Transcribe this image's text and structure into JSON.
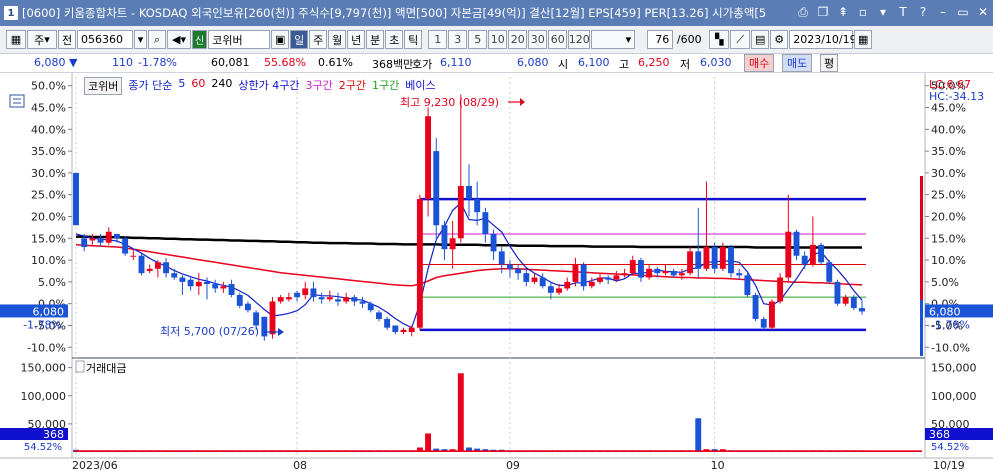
{
  "window": {
    "number": "1",
    "title": "[0600] 키움종합차트 - KOSDAQ 외국인보유[260(천)] 주식수[9,797(천)] 액면[500] 자본금[49(억)] 결산[12월] EPS[459] PER[13.26] 시가총액[5",
    "buttons": [
      "⎙",
      "❐",
      "⇞",
      "▫",
      "▾",
      "T",
      "?",
      "▭",
      "–",
      "▭",
      "✕"
    ]
  },
  "toolbar": {
    "market": "주",
    "prefix": "전",
    "code": "056360",
    "new_badge": "신",
    "stock_name": "코위버",
    "periods": [
      "일",
      "주",
      "월",
      "년",
      "분",
      "초",
      "틱"
    ],
    "minutes": [
      "1",
      "3",
      "5",
      "10",
      "20",
      "30",
      "60",
      "120"
    ],
    "count": "76",
    "total": "/600",
    "date": "2023/10/19"
  },
  "quote": {
    "price": "6,080 ▼",
    "change": "110",
    "rate": "-1.78%",
    "volume": "60,081",
    "vol_ratio": "55.68%",
    "turnover": "0.61%",
    "amount": "368백만",
    "bid_label": "호가",
    "bid": "6,110",
    "ask": "6,080",
    "open_label": "시",
    "open": "6,100",
    "high_label": "고",
    "high": "6,250",
    "low_label": "저",
    "low": "6,030",
    "buy": "매수",
    "sell": "매도",
    "avg": "평"
  },
  "legend": {
    "name": "코위버",
    "ma_label": "종가 단순",
    "ma5": "5",
    "ma60": "60",
    "ma240": "240",
    "env_label": "상한가 4구간",
    "z3": "3구간",
    "z2": "2구간",
    "z1": "1구간",
    "base": "베이스"
  },
  "right_top": {
    "lc": "LC:6.67",
    "hc": "HC:-34.13"
  },
  "annotations": {
    "high": "최고 9,230 (08/29)",
    "low": "최저 5,700 (07/26)"
  },
  "price_axis": [
    "50.0%",
    "45.0%",
    "40.0%",
    "35.0%",
    "30.0%",
    "25.0%",
    "20.0%",
    "15.0%",
    "10.0%",
    "5.0%",
    "0.0%",
    "-5.0%",
    "-10.0%"
  ],
  "price_tag": {
    "value": "6,080",
    "rate": "-1.78%"
  },
  "volume_panel": {
    "label": "거래대금",
    "axis": [
      "150,000",
      "100,000",
      "50,000"
    ],
    "tag": "368",
    "tag_rate": "54.52%"
  },
  "date_axis": [
    "2023/06",
    "08",
    "09",
    "10",
    "10/19"
  ],
  "colors": {
    "up": "#e8001c",
    "down": "#1a53d6",
    "ma5": "#1020c8",
    "ma60": "#e8001c",
    "ma240": "#000000",
    "titlebar": "#5b7db5"
  },
  "chart_data": {
    "type": "candlestick",
    "base_price": 6190,
    "pct_range": [
      -12,
      52
    ],
    "candles": [
      [
        30.0,
        18.0,
        18.0,
        20.3
      ],
      [
        15.0,
        13.0,
        12.0,
        16.0
      ],
      [
        14.5,
        15.0,
        13.5,
        16.0
      ],
      [
        15.0,
        14.0,
        13.0,
        16.0
      ],
      [
        14.0,
        16.5,
        13.5,
        17.5
      ],
      [
        16.0,
        15.0,
        14.0,
        16.0
      ],
      [
        15.0,
        11.5,
        11.0,
        15.5
      ],
      [
        11.0,
        11.0,
        10.0,
        12.5
      ],
      [
        11.0,
        7.0,
        6.5,
        11.5
      ],
      [
        7.5,
        8.0,
        7.0,
        9.0
      ],
      [
        8.0,
        9.5,
        6.0,
        10.0
      ],
      [
        9.5,
        7.0,
        6.0,
        10.5
      ],
      [
        7.0,
        6.0,
        5.5,
        8.0
      ],
      [
        6.0,
        5.0,
        2.0,
        6.5
      ],
      [
        5.5,
        4.0,
        3.0,
        6.0
      ],
      [
        4.0,
        5.0,
        2.0,
        7.0
      ],
      [
        5.0,
        4.5,
        1.0,
        6.0
      ],
      [
        4.5,
        3.5,
        2.5,
        5.5
      ],
      [
        3.5,
        4.0,
        2.5,
        5.0
      ],
      [
        4.5,
        2.0,
        1.5,
        5.5
      ],
      [
        2.0,
        -0.5,
        -1.0,
        2.5
      ],
      [
        0.0,
        -1.5,
        -2.0,
        0.5
      ],
      [
        -2.0,
        -5.0,
        -6.0,
        -1.5
      ],
      [
        -3.0,
        -7.5,
        -8.5,
        -3.0
      ],
      [
        -7.0,
        0.5,
        -8.0,
        1.5
      ],
      [
        0.5,
        1.5,
        0.0,
        2.0
      ],
      [
        1.0,
        1.5,
        0.5,
        2.5
      ],
      [
        2.5,
        1.5,
        0.5,
        3.0
      ],
      [
        2.0,
        3.5,
        1.0,
        5.0
      ],
      [
        3.5,
        1.5,
        0.5,
        5.0
      ],
      [
        1.5,
        1.0,
        0.0,
        2.5
      ],
      [
        1.0,
        1.5,
        0.5,
        3.0
      ],
      [
        1.0,
        0.5,
        -0.5,
        2.5
      ],
      [
        0.5,
        1.5,
        0.0,
        2.5
      ],
      [
        1.5,
        0.5,
        -0.5,
        2.0
      ],
      [
        0.5,
        0.0,
        -1.0,
        1.5
      ],
      [
        0.0,
        -1.5,
        -2.0,
        0.5
      ],
      [
        -2.0,
        -3.5,
        -4.0,
        -1.5
      ],
      [
        -3.5,
        -5.5,
        -6.0,
        -3.0
      ],
      [
        -5.0,
        -6.5,
        -7.0,
        -5.0
      ],
      [
        -6.5,
        -6.0,
        -7.0,
        -5.5
      ],
      [
        -6.5,
        -5.5,
        -7.5,
        -5.0
      ],
      [
        -5.5,
        24.0,
        -6.0,
        25.0
      ],
      [
        24.0,
        43.0,
        20.0,
        45.0
      ],
      [
        35.0,
        18.0,
        15.0,
        38.0
      ],
      [
        18.0,
        12.5,
        10.0,
        19.0
      ],
      [
        12.5,
        15.0,
        8.0,
        19.0
      ],
      [
        15.0,
        27.0,
        14.0,
        48.0
      ],
      [
        27.0,
        24.0,
        20.0,
        32.0
      ],
      [
        24.0,
        21.0,
        18.0,
        28.0
      ],
      [
        21.0,
        16.0,
        14.0,
        22.0
      ],
      [
        16.0,
        12.0,
        10.0,
        17.0
      ],
      [
        12.0,
        9.0,
        7.0,
        13.0
      ],
      [
        9.0,
        8.0,
        6.0,
        10.0
      ],
      [
        8.0,
        7.0,
        5.5,
        9.0
      ],
      [
        7.0,
        5.0,
        4.0,
        8.0
      ],
      [
        5.0,
        6.0,
        4.5,
        7.0
      ],
      [
        6.0,
        4.0,
        3.5,
        7.0
      ],
      [
        4.0,
        2.5,
        1.0,
        5.0
      ],
      [
        2.5,
        3.5,
        2.0,
        4.5
      ],
      [
        3.5,
        5.0,
        3.0,
        6.0
      ],
      [
        5.0,
        9.0,
        4.0,
        10.5
      ],
      [
        9.0,
        4.0,
        3.0,
        9.5
      ],
      [
        4.0,
        5.0,
        3.5,
        6.0
      ],
      [
        5.0,
        6.0,
        4.5,
        7.0
      ],
      [
        6.0,
        5.5,
        4.5,
        6.5
      ],
      [
        5.5,
        6.5,
        5.0,
        7.5
      ],
      [
        6.5,
        7.0,
        6.0,
        8.0
      ],
      [
        7.0,
        10.0,
        6.5,
        11.0
      ],
      [
        10.0,
        6.0,
        5.0,
        10.5
      ],
      [
        6.0,
        8.0,
        5.5,
        9.0
      ],
      [
        8.0,
        7.0,
        6.0,
        8.5
      ],
      [
        7.0,
        7.5,
        6.5,
        9.0
      ],
      [
        7.5,
        6.5,
        6.0,
        8.0
      ],
      [
        6.5,
        7.0,
        5.5,
        8.0
      ],
      [
        7.0,
        12.0,
        6.5,
        13.0
      ],
      [
        12.0,
        8.0,
        6.0,
        22.0
      ],
      [
        8.0,
        13.0,
        7.5,
        28.0
      ],
      [
        13.0,
        8.0,
        7.0,
        14.0
      ],
      [
        8.0,
        13.0,
        7.5,
        14.0
      ],
      [
        13.0,
        7.0,
        6.0,
        13.5
      ],
      [
        7.0,
        6.5,
        5.5,
        8.0
      ],
      [
        6.5,
        2.0,
        1.5,
        7.0
      ],
      [
        2.0,
        -3.5,
        -4.0,
        2.5
      ],
      [
        -3.5,
        -5.5,
        -6.0,
        -3.0
      ],
      [
        -5.5,
        0.5,
        -6.0,
        1.0
      ],
      [
        0.5,
        6.0,
        0.0,
        7.0
      ],
      [
        6.0,
        16.5,
        5.0,
        25.0
      ],
      [
        16.5,
        11.0,
        10.0,
        17.0
      ],
      [
        11.0,
        9.0,
        8.0,
        12.0
      ],
      [
        9.0,
        13.5,
        8.5,
        20.0
      ],
      [
        13.5,
        9.5,
        9.0,
        14.0
      ],
      [
        9.5,
        5.0,
        4.5,
        10.0
      ],
      [
        5.0,
        0.0,
        -0.5,
        5.5
      ],
      [
        0.0,
        1.5,
        -0.5,
        2.0
      ],
      [
        1.5,
        -1.0,
        -1.5,
        2.0
      ],
      [
        -1.0,
        -1.78,
        -2.5,
        0.8
      ]
    ],
    "ma5": [
      16,
      15.5,
      15,
      14.8,
      14.6,
      14.4,
      13.6,
      12.6,
      11.6,
      10.4,
      9.4,
      8.6,
      7.6,
      6.8,
      6.2,
      5.6,
      5.2,
      4.6,
      4.2,
      3.8,
      2.9,
      1.9,
      0.3,
      -1.3,
      -2.8,
      -2.6,
      -2.2,
      -1.6,
      -0.2,
      2.1,
      1.8,
      1.8,
      1.6,
      1.3,
      1.0,
      0.8,
      0.0,
      -0.8,
      -2.0,
      -3.4,
      -4.6,
      -5.5,
      0.0,
      8.0,
      14.7,
      17.7,
      21.4,
      23.1,
      19.3,
      19.1,
      19.6,
      18.0,
      16.4,
      13.2,
      10.4,
      8.2,
      7.0,
      6.0,
      4.9,
      4.2,
      4.2,
      4.8,
      4.8,
      5.3,
      5.9,
      5.9,
      5.2,
      5.7,
      7.0,
      6.9,
      7.3,
      7.7,
      7.4,
      7.3,
      7.2,
      8.0,
      8.2,
      9.5,
      9.6,
      9.8,
      9.8,
      9.5,
      7.3,
      4.2,
      0.0,
      -0.3,
      0.7,
      3.3,
      5.7,
      8.6,
      11.2,
      11.9,
      9.6,
      7.8,
      5.6,
      3.0,
      0.8
    ],
    "ma60": [
      13.5,
      13.4,
      13.3,
      13.2,
      13.1,
      13.0,
      12.8,
      12.5,
      12.2,
      11.9,
      11.6,
      11.3,
      11.0,
      10.7,
      10.4,
      10.1,
      9.8,
      9.5,
      9.2,
      8.9,
      8.6,
      8.3,
      8.0,
      7.7,
      7.4,
      7.1,
      6.9,
      6.7,
      6.5,
      6.3,
      6.1,
      5.9,
      5.7,
      5.5,
      5.3,
      5.1,
      4.9,
      4.7,
      4.5,
      4.3,
      4.2,
      4.1,
      4.5,
      5.2,
      6.0,
      6.4,
      6.7,
      7.0,
      7.3,
      7.6,
      7.8,
      7.9,
      8.0,
      8.0,
      8.0,
      7.9,
      7.8,
      7.7,
      7.6,
      7.5,
      7.4,
      7.3,
      7.2,
      7.1,
      7.0,
      6.9,
      6.8,
      6.7,
      6.6,
      6.5,
      6.4,
      6.3,
      6.2,
      6.1,
      6.0,
      6.0,
      5.9,
      5.9,
      5.8,
      5.8,
      5.7,
      5.6,
      5.5,
      5.4,
      5.3,
      5.2,
      5.1,
      5.0,
      4.9,
      4.9,
      4.8,
      4.8,
      4.7,
      4.6,
      4.5,
      4.4,
      4.3
    ],
    "ma240": [
      15.4,
      15.4,
      15.3,
      15.3,
      15.3,
      15.2,
      15.2,
      15.1,
      15.1,
      15.0,
      15.0,
      14.9,
      14.9,
      14.8,
      14.8,
      14.7,
      14.7,
      14.6,
      14.6,
      14.5,
      14.5,
      14.4,
      14.4,
      14.3,
      14.3,
      14.2,
      14.2,
      14.1,
      14.1,
      14.0,
      14.0,
      13.9,
      13.9,
      13.9,
      13.8,
      13.8,
      13.8,
      13.7,
      13.7,
      13.7,
      13.6,
      13.6,
      13.6,
      13.6,
      13.6,
      13.5,
      13.5,
      13.5,
      13.5,
      13.5,
      13.4,
      13.4,
      13.4,
      13.4,
      13.3,
      13.3,
      13.3,
      13.3,
      13.2,
      13.2,
      13.2,
      13.2,
      13.2,
      13.1,
      13.1,
      13.1,
      13.1,
      13.1,
      13.1,
      13.0,
      13.0,
      13.0,
      13.0,
      13.0,
      13.0,
      13.0,
      13.0,
      13.0,
      13.0,
      13.0,
      13.0,
      13.0,
      13.0,
      12.9,
      12.9,
      12.9,
      12.9,
      12.9,
      12.9,
      12.9,
      12.9,
      12.9,
      12.9,
      12.9,
      12.9,
      12.9,
      12.9
    ],
    "bands": [
      {
        "name": "상한가 4구간",
        "y": 24.0,
        "color": "#1010d0",
        "width": 2.5
      },
      {
        "name": "3구간",
        "y": 16.0,
        "color": "#d020d0",
        "width": 1
      },
      {
        "name": "2구간",
        "y": 9.0,
        "color": "#e00000",
        "width": 1
      },
      {
        "name": "1구간",
        "y": 1.5,
        "color": "#20a020",
        "width": 1
      },
      {
        "name": "베이스",
        "y": -6.0,
        "color": "#1010d0",
        "width": 2.5
      }
    ],
    "band_start_index": 42,
    "volume": [
      4,
      3,
      3,
      3,
      3,
      3,
      3,
      3,
      3,
      3,
      3,
      3,
      3,
      3,
      3,
      3,
      3,
      3,
      3,
      3,
      3,
      3,
      3,
      3,
      3,
      3,
      3,
      3,
      3,
      3,
      3,
      3,
      3,
      3,
      3,
      3,
      3,
      3,
      3,
      3,
      3,
      3,
      8,
      33,
      6,
      5,
      5,
      140,
      8,
      6,
      5,
      4,
      4,
      3,
      3,
      3,
      3,
      3,
      3,
      3,
      3,
      3,
      3,
      3,
      3,
      3,
      3,
      3,
      3,
      3,
      3,
      3,
      3,
      3,
      3,
      3,
      60,
      5,
      5,
      5,
      3,
      3,
      3,
      3,
      3,
      3,
      3,
      3,
      3,
      3,
      3,
      3,
      3,
      3,
      3,
      3,
      3
    ],
    "volume_ylim": [
      0,
      160
    ],
    "date_ticks": [
      {
        "label": "2023/06",
        "index": 0
      },
      {
        "label": "08",
        "index": 27
      },
      {
        "label": "09",
        "index": 53
      },
      {
        "label": "10",
        "index": 78
      }
    ]
  }
}
